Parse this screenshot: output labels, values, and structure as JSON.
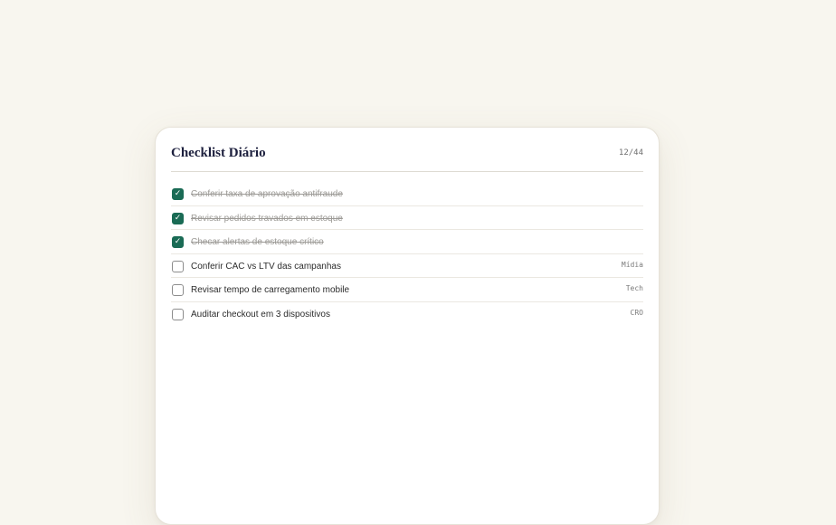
{
  "card": {
    "title": "Checklist Diário",
    "counter": "12/44"
  },
  "colors": {
    "background": "#f8f6ef",
    "accent": "#1a6b55",
    "title": "#1c1f3d"
  },
  "items": [
    {
      "label": "Conferir taxa de aprovação antifraude",
      "checked": true,
      "tag": ""
    },
    {
      "label": "Revisar pedidos travados em estoque",
      "checked": true,
      "tag": ""
    },
    {
      "label": "Checar alertas de estoque crítico",
      "checked": true,
      "tag": ""
    },
    {
      "label": "Conferir CAC vs LTV das campanhas",
      "checked": false,
      "tag": "Mídia"
    },
    {
      "label": "Revisar tempo de carregamento mobile",
      "checked": false,
      "tag": "Tech"
    },
    {
      "label": "Auditar checkout em 3 dispositivos",
      "checked": false,
      "tag": "CRO"
    }
  ],
  "icons": {
    "check": "check-icon"
  }
}
